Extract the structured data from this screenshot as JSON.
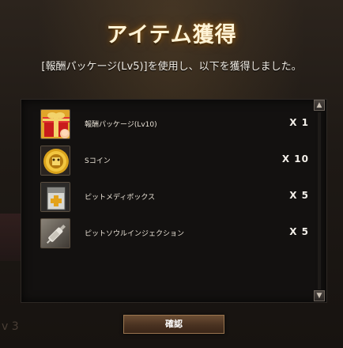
{
  "dialog": {
    "title": "アイテム獲得",
    "message": "[報酬パッケージ(Lv5)]を使用し、以下を獲得しました。"
  },
  "items": [
    {
      "name": "報酬パッケージ(Lv10)",
      "qty": "X 1",
      "icon": "gift-box-icon"
    },
    {
      "name": "Sコイン",
      "qty": "X 10",
      "icon": "coin-icon"
    },
    {
      "name": "ピットメディボックス",
      "qty": "X 5",
      "icon": "medbox-icon"
    },
    {
      "name": "ピットソウルインジェクション",
      "qty": "X 5",
      "icon": "injection-icon"
    }
  ],
  "confirm_button": {
    "label": "確認"
  },
  "background_text": "v 3",
  "colors": {
    "title_glow": "#a06a1e",
    "panel_bg": "#131110",
    "button_bg": "#4a3221"
  }
}
